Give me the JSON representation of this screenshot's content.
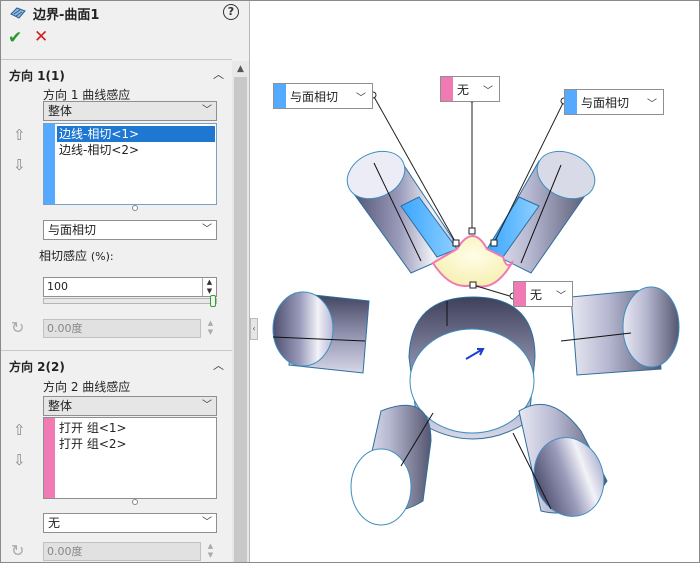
{
  "title": "边界-曲面1",
  "help_glyph": "?",
  "ok_glyph": "✔",
  "cancel_glyph": "✕",
  "direction1": {
    "header": "方向 1(1)",
    "curve_label": "方向 1 曲线感应",
    "curve_mode": "整体",
    "items": [
      "边线-相切<1>",
      "边线-相切<2>"
    ],
    "tangent_type": "与面相切",
    "influence_label": "相切感应",
    "influence_unit": "(%):",
    "influence_value": "100",
    "angle_value": "0.00度",
    "strip_color": "#55aaff",
    "selected_color": "#1e78d2"
  },
  "direction2": {
    "header": "方向 2(2)",
    "curve_label": "方向 2 曲线感应",
    "curve_mode": "整体",
    "items": [
      "打开 组<1>",
      "打开 组<2>"
    ],
    "tangent_type": "无",
    "angle_value": "0.00度",
    "strip_color": "#f07ab4"
  },
  "viewport": {
    "callouts": [
      {
        "text": "与面相切",
        "color": "#55aaff"
      },
      {
        "text": "无",
        "color": "#f07ab4"
      },
      {
        "text": "与面相切",
        "color": "#55aaff"
      },
      {
        "text": "无",
        "color": "#f07ab4"
      }
    ]
  }
}
